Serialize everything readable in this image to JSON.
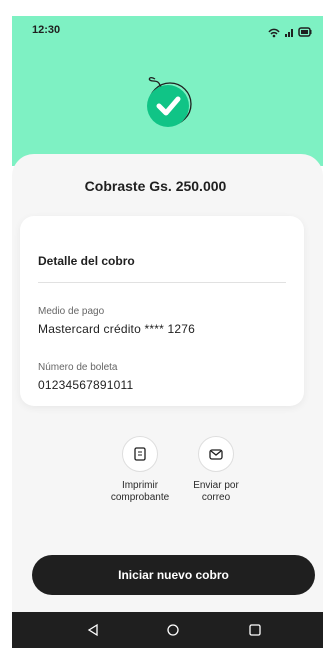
{
  "status_bar": {
    "time": "12:30",
    "icons": [
      "wifi-icon",
      "signal-icon",
      "battery-icon"
    ]
  },
  "success": {
    "icon": "check-circle-icon",
    "accent_color": "#7ef1c3",
    "check_color": "#10c486"
  },
  "headline": "Cobraste Gs. 250.000",
  "detail_card": {
    "title": "Detalle del cobro",
    "payment_method_label": "Medio de pago",
    "payment_method_value": "Mastercard crédito **** 1276",
    "receipt_label": "Número de boleta",
    "receipt_value": "01234567891011"
  },
  "actions": [
    {
      "icon": "receipt-icon",
      "line1": "Imprimir",
      "line2": "comprobante"
    },
    {
      "icon": "mail-icon",
      "line1": "Enviar por",
      "line2": "correo"
    }
  ],
  "primary_button": "Iniciar nuevo cobro",
  "navigation": {
    "icons": [
      "back-icon",
      "home-icon",
      "recents-icon"
    ]
  }
}
